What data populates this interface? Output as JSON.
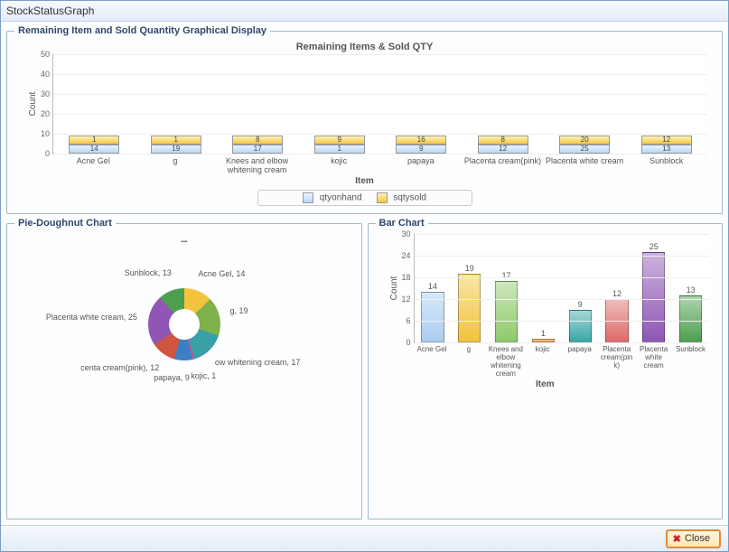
{
  "window": {
    "title": "StockStatusGraph"
  },
  "topBox": {
    "legend": "Remaining Item and Sold Quantity Graphical Display"
  },
  "pieBox": {
    "legend": "Pie-Doughnut Chart"
  },
  "barBox": {
    "legend": "Bar Chart"
  },
  "footer": {
    "close_label": "Close"
  },
  "chart_data": [
    {
      "id": "stacked_top",
      "type": "bar",
      "stacked": true,
      "title": "Remaining Items & Sold QTY",
      "xlabel": "Item",
      "ylabel": "Count",
      "ylim": [
        0,
        50
      ],
      "ytick_step": 10,
      "categories": [
        "Acne Gel",
        "g",
        "Knees and elbow whitening cream",
        "kojic",
        "papaya",
        "Placenta cream(pink)",
        "Placenta white cream",
        "Sunblock"
      ],
      "series": [
        {
          "name": "qtyonhand",
          "color": "#b8d8f5",
          "values": [
            14,
            19,
            17,
            1,
            9,
            12,
            25,
            13
          ]
        },
        {
          "name": "sqtysold",
          "color": "#f6c93f",
          "values": [
            1,
            1,
            8,
            9,
            16,
            8,
            20,
            12
          ]
        }
      ],
      "legend": [
        "qtyonhand",
        "sqtysold"
      ]
    },
    {
      "id": "doughnut",
      "type": "pie",
      "title": "--",
      "categories": [
        "Acne Gel",
        "g",
        "Knees and elbow whitening cream",
        "kojic",
        "papaya",
        "Placenta cream(pink)",
        "Placenta white cream",
        "Sunblock"
      ],
      "values": [
        14,
        19,
        17,
        1,
        9,
        12,
        25,
        13
      ],
      "labels": [
        "Acne Gel, 14",
        "g, 19",
        "ow whitening cream, 17",
        "kojic, 1",
        "papaya, 9",
        "centa cream(pink), 12",
        "Placenta white cream, 25",
        "Sunblock, 13"
      ],
      "colors": [
        "#f3c33d",
        "#7fb24a",
        "#39a0a7",
        "#c94f9b",
        "#3b7fc4",
        "#d0553f",
        "#8f56b5",
        "#4d9f4d"
      ]
    },
    {
      "id": "bar_bottom",
      "type": "bar",
      "title": "",
      "xlabel": "Item",
      "ylabel": "Count",
      "ylim": [
        0,
        30
      ],
      "ytick_step": 6,
      "categories": [
        "Acne Gel",
        "g",
        "Knees and elbow whitening cream",
        "kojic",
        "papaya",
        "Placenta cream(pink)",
        "Placenta white cream",
        "Sunblock"
      ],
      "values": [
        14,
        19,
        17,
        1,
        9,
        12,
        25,
        13
      ],
      "colors": [
        "#a9cdef",
        "#f3c33d",
        "#8fc96a",
        "#e69a3f",
        "#3aa6a6",
        "#e06a6a",
        "#8f56b5",
        "#4d9f4d"
      ]
    }
  ]
}
